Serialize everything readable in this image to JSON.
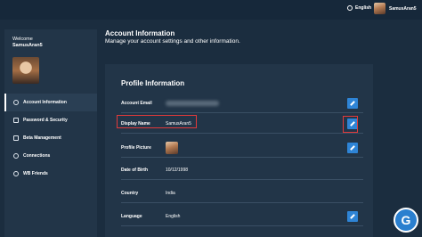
{
  "topbar": {
    "language": "English",
    "user": "SamusAran5"
  },
  "sidebar": {
    "welcome": "Welcome",
    "username": "SamusAran5",
    "items": [
      {
        "label": "Account Information",
        "icon": "info-icon",
        "active": true
      },
      {
        "label": "Password & Security",
        "icon": "shield-icon",
        "active": false
      },
      {
        "label": "Beta Management",
        "icon": "beta-icon",
        "active": false
      },
      {
        "label": "Connections",
        "icon": "link-icon",
        "active": false
      },
      {
        "label": "WB Friends",
        "icon": "friends-icon",
        "active": false
      }
    ]
  },
  "main": {
    "title": "Account Information",
    "subtitle": "Manage your account settings and other information."
  },
  "profile": {
    "title": "Profile Information",
    "rows": [
      {
        "label": "Account Email",
        "value": ""
      },
      {
        "label": "Display Name",
        "value": "SamusAran5"
      },
      {
        "label": "Profile Picture",
        "value": ""
      },
      {
        "label": "Date of Birth",
        "value": "10/12/1998"
      },
      {
        "label": "Country",
        "value": "India"
      },
      {
        "label": "Language",
        "value": "English"
      }
    ]
  },
  "colors": {
    "accent": "#2e84d6",
    "highlight": "#e23a3a",
    "background": "#1b2d3f",
    "panel": "#223548"
  }
}
